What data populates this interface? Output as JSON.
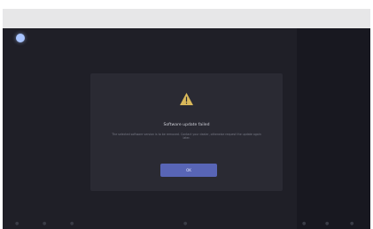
{
  "dialog": {
    "title": "Software update failed",
    "body": "The selected software version is to be removed. Contact your dealer, otherwise request the update again later.",
    "ok_label": "OK"
  },
  "colors": {
    "screen": "#1f1f27",
    "dialog": "#2a2a33",
    "accent": "#5865b6",
    "warning": "#d9b85a"
  },
  "icons": {
    "user": "user-dot-icon",
    "warning": "warning-triangle-icon"
  }
}
